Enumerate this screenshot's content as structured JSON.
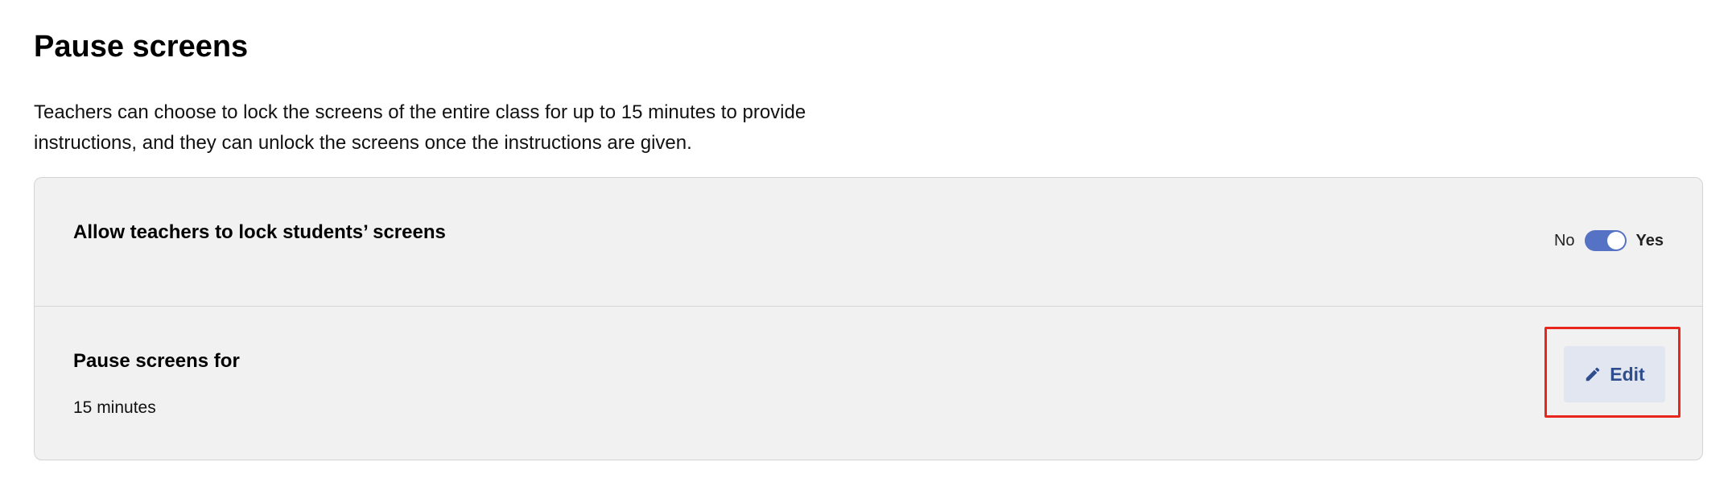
{
  "page": {
    "title": "Pause screens",
    "description": "Teachers can choose to lock the screens of the entire class for up to 15 minutes to provide instructions, and they can unlock the screens once the instructions are given."
  },
  "settings": {
    "lock_screens": {
      "label": "Allow teachers to lock students’ screens",
      "toggle_off_label": "No",
      "toggle_on_label": "Yes",
      "enabled": true
    },
    "pause_duration": {
      "label": "Pause screens for",
      "value": "15 minutes",
      "edit_label": "Edit",
      "edit_icon": "pencil-icon"
    }
  },
  "colors": {
    "toggle_on": "#5672c4",
    "edit_text": "#2e4d8f",
    "edit_bg": "#e2e6f0",
    "highlight": "#e8261b",
    "card_bg": "#f1f1f1"
  }
}
